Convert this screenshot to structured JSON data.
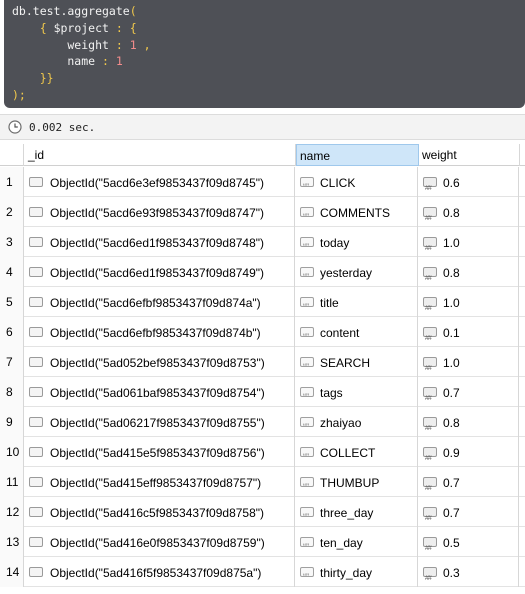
{
  "editor": {
    "lines": [
      [
        {
          "t": "plain",
          "v": "db.test.aggregate"
        },
        {
          "t": "punct",
          "v": "("
        }
      ],
      [
        {
          "t": "plain",
          "v": "    "
        },
        {
          "t": "punct",
          "v": "{"
        },
        {
          "t": "plain",
          "v": " $project "
        },
        {
          "t": "punct",
          "v": ":"
        },
        {
          "t": "plain",
          "v": " "
        },
        {
          "t": "punct",
          "v": "{"
        }
      ],
      [
        {
          "t": "plain",
          "v": "        weight "
        },
        {
          "t": "punct",
          "v": ":"
        },
        {
          "t": "plain",
          "v": " "
        },
        {
          "t": "num",
          "v": "1"
        },
        {
          "t": "plain",
          "v": " "
        },
        {
          "t": "punct",
          "v": ","
        }
      ],
      [
        {
          "t": "plain",
          "v": "        name "
        },
        {
          "t": "punct",
          "v": ":"
        },
        {
          "t": "plain",
          "v": " "
        },
        {
          "t": "num",
          "v": "1"
        }
      ],
      [
        {
          "t": "plain",
          "v": "    "
        },
        {
          "t": "punct",
          "v": "}}"
        }
      ],
      [
        {
          "t": "punct",
          "v": ");"
        }
      ]
    ]
  },
  "status": {
    "icon": "clock-icon",
    "time": "0.002 sec."
  },
  "grid": {
    "columns": [
      {
        "label": "_id",
        "selected": false
      },
      {
        "label": "name",
        "selected": true
      },
      {
        "label": "weight",
        "selected": false
      }
    ],
    "rows": [
      {
        "num": "1",
        "id": "ObjectId(\"5acd6e3ef9853437f09d8745\")",
        "name": "CLICK",
        "weight": "0.6"
      },
      {
        "num": "2",
        "id": "ObjectId(\"5acd6e93f9853437f09d8747\")",
        "name": "COMMENTS",
        "weight": "0.8"
      },
      {
        "num": "3",
        "id": "ObjectId(\"5acd6ed1f9853437f09d8748\")",
        "name": "today",
        "weight": "1.0"
      },
      {
        "num": "4",
        "id": "ObjectId(\"5acd6ed1f9853437f09d8749\")",
        "name": "yesterday",
        "weight": "0.8"
      },
      {
        "num": "5",
        "id": "ObjectId(\"5acd6efbf9853437f09d874a\")",
        "name": "title",
        "weight": "1.0"
      },
      {
        "num": "6",
        "id": "ObjectId(\"5acd6efbf9853437f09d874b\")",
        "name": "content",
        "weight": "0.1"
      },
      {
        "num": "7",
        "id": "ObjectId(\"5ad052bef9853437f09d8753\")",
        "name": "SEARCH",
        "weight": "1.0"
      },
      {
        "num": "8",
        "id": "ObjectId(\"5ad061baf9853437f09d8754\")",
        "name": "tags",
        "weight": "0.7"
      },
      {
        "num": "9",
        "id": "ObjectId(\"5ad06217f9853437f09d8755\")",
        "name": "zhaiyao",
        "weight": "0.8"
      },
      {
        "num": "10",
        "id": "ObjectId(\"5ad415e5f9853437f09d8756\")",
        "name": "COLLECT",
        "weight": "0.9"
      },
      {
        "num": "11",
        "id": "ObjectId(\"5ad415eff9853437f09d8757\")",
        "name": "THUMBUP",
        "weight": "0.7"
      },
      {
        "num": "12",
        "id": "ObjectId(\"5ad416c5f9853437f09d8758\")",
        "name": "three_day",
        "weight": "0.7"
      },
      {
        "num": "13",
        "id": "ObjectId(\"5ad416e0f9853437f09d8759\")",
        "name": "ten_day",
        "weight": "0.5"
      },
      {
        "num": "14",
        "id": "ObjectId(\"5ad416f5f9853437f09d875a\")",
        "name": "thirty_day",
        "weight": "0.3"
      }
    ]
  },
  "colors": {
    "editor_bg": "#4e5056",
    "punct": "#f2c94c",
    "number": "#f28c8c",
    "header_selected": "#cfe6f9"
  }
}
